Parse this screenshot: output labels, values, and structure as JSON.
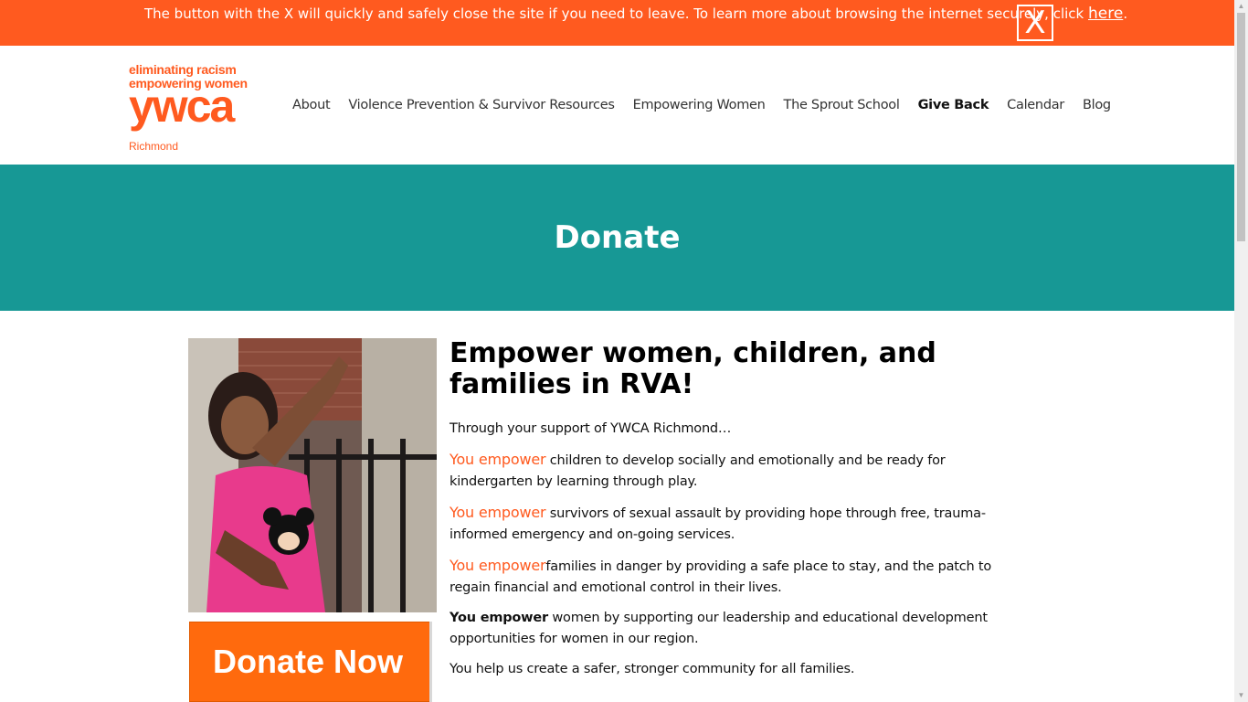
{
  "alert": {
    "text": "The button with the X will quickly and safely close the site if you need to leave. To learn more about browsing the internet securely, click ",
    "link_label": "here",
    "period": ".",
    "exit_label": "X"
  },
  "logo": {
    "tagline_1": "eliminating racism",
    "tagline_2": "empowering women",
    "mark": "ywca",
    "city": "Richmond"
  },
  "nav": {
    "items": [
      {
        "label": "About"
      },
      {
        "label": "Violence Prevention & Survivor Resources"
      },
      {
        "label": "Empowering Women"
      },
      {
        "label": "The Sprout School"
      },
      {
        "label": "Give Back"
      },
      {
        "label": "Calendar"
      },
      {
        "label": "Blog"
      }
    ]
  },
  "hero": {
    "title": "Donate"
  },
  "content": {
    "title": "Empower women, children, and families in RVA!",
    "intro": "Through your support of YWCA Richmond…",
    "items": [
      {
        "lead": "You empower",
        "text": " children to develop socially and emotionally and be ready for kindergarten by learning through play."
      },
      {
        "lead": "You empower",
        "text": " survivors of sexual assault by providing hope through free, trauma-informed emergency and on-going services."
      },
      {
        "lead": "You empower",
        "text": "families in danger by providing a safe place to stay, and the patch to regain financial and emotional control in their lives."
      },
      {
        "lead": "You empower",
        "text": " women by supporting our leadership and educational development opportunities for women in our region."
      }
    ],
    "closing": "You help us create a safer, stronger community for all families."
  },
  "donate_button": {
    "label": "Donate Now"
  },
  "colors": {
    "brand": "#ff5a1f",
    "hero_bg": "#179895",
    "button": "#ff6a0d"
  }
}
